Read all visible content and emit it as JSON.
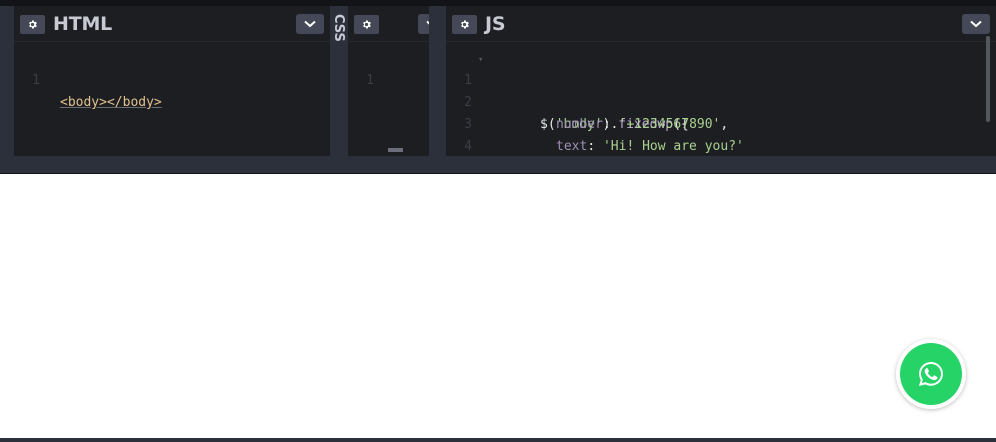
{
  "html_pane": {
    "title": "HTML",
    "lines": [
      {
        "num": "1",
        "code": "<body></body>"
      }
    ]
  },
  "css_pane": {
    "title": "CSS",
    "lines": [
      {
        "num": "1"
      }
    ]
  },
  "js_pane": {
    "title": "JS",
    "lines": [
      {
        "num": "1"
      },
      {
        "num": "2"
      },
      {
        "num": "3"
      },
      {
        "num": "4"
      }
    ],
    "tokens": {
      "l1_a": "$(",
      "l1_b": "'body'",
      "l1_c": ").",
      "l1_d": "fixedwp",
      "l1_e": "({",
      "l2_key": "number",
      "l2_colon": ": ",
      "l2_val": "'+1234567890'",
      "l2_comma": ",",
      "l3_key": "text",
      "l3_colon": ": ",
      "l3_val": "'Hi! How are you?'",
      "l4": "});"
    }
  },
  "icons": {
    "settings": "gear-icon",
    "collapse": "chevron-down-icon",
    "whatsapp": "whatsapp-icon"
  },
  "colors": {
    "editor_bg": "#1d1e22",
    "chrome": "#2c303a",
    "button": "#444857",
    "whatsapp_green": "#25d366"
  }
}
